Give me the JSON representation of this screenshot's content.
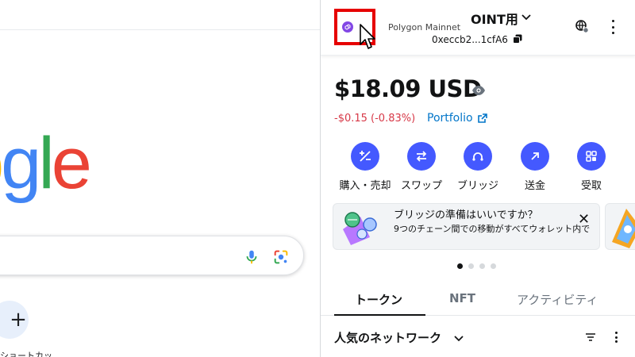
{
  "google": {
    "logo_letters": [
      "o",
      "g",
      "l",
      "e"
    ],
    "logo_colors": [
      "#fbbc05",
      "#4285f4",
      "#34a853",
      "#ea4335"
    ],
    "shortcut_add_symbol": "+",
    "shortcut_label": "ショートカッ"
  },
  "wallet": {
    "network_name": "Polygon Mainnet",
    "network_color": "#8247e5",
    "account_name": "OINT用",
    "account_address": "0xeccb2...1cfA6",
    "balance": "$18.09 USD",
    "balance_change": "-$0.15 (-0.83%)",
    "portfolio_label": "Portfolio",
    "actions": [
      {
        "label": "購入・売却",
        "icon": "plus-minus-icon"
      },
      {
        "label": "スワップ",
        "icon": "swap-icon"
      },
      {
        "label": "ブリッジ",
        "icon": "bridge-icon"
      },
      {
        "label": "送金",
        "icon": "send-arrow-icon"
      },
      {
        "label": "受取",
        "icon": "receive-qr-icon"
      }
    ],
    "banner": {
      "title": "ブリッジの準備はいいですか？",
      "body": "9つのチェーン間での移動がすべてウォレット内で",
      "close_symbol": "✕"
    },
    "carousel": {
      "count": 4,
      "active_index": 0
    },
    "tabs": [
      {
        "label": "トークン",
        "active": true
      },
      {
        "label": "NFT",
        "active": false
      },
      {
        "label": "アクティビティ",
        "active": false
      }
    ],
    "popular_networks_label": "人気のネットワーク",
    "accent_color": "#4459ff",
    "negative_color": "#d73847",
    "link_color": "#0376c9",
    "highlight_color": "#e60000"
  }
}
